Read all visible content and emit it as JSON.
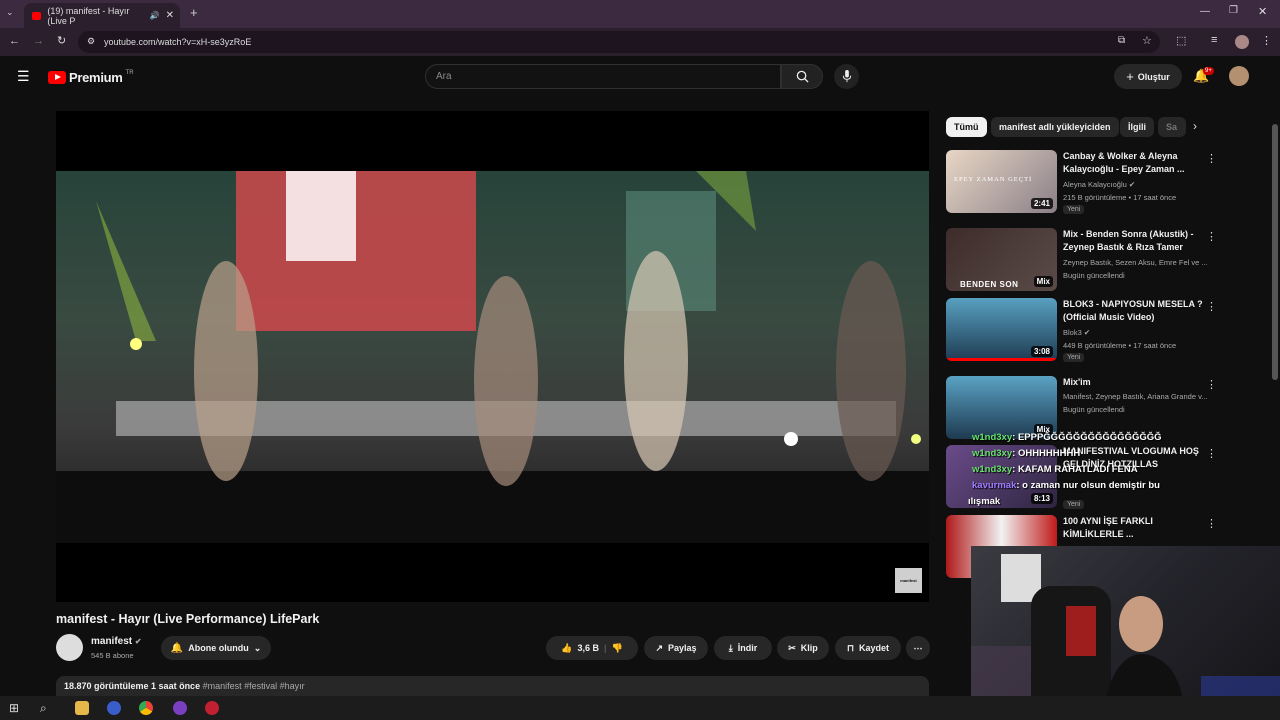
{
  "browser": {
    "tab_title": "(19) manifest - Hayır (Live P",
    "url": "youtube.com/watch?v=xH-se3yzRoE"
  },
  "header": {
    "logo_text": "Premium",
    "region": "TR",
    "search_placeholder": "Ara",
    "create_label": "Oluştur",
    "notif_count": "9+"
  },
  "video": {
    "title": "manifest - Hayır (Live Performance) LifePark",
    "watermark": "manifest",
    "channel": "manifest",
    "subscribers": "545 B abone",
    "subscribed_label": "Abone olundu",
    "likes": "3,6 B",
    "share_label": "Paylaş",
    "download_label": "İndir",
    "clip_label": "Klip",
    "save_label": "Kaydet",
    "views": "18.870 görüntüleme",
    "posted": "1 saat önce",
    "tags": "#manifest #festival #hayır"
  },
  "chips": [
    "Tümü",
    "manifest adlı yükleyiciden",
    "İlgili",
    "Sa"
  ],
  "recommendations": [
    {
      "title": "Canbay & Wolker & Aleyna Kalaycıoğlu - Epey Zaman ...",
      "channel": "Aleyna Kalaycıoğlu",
      "meta": "215 B görüntüleme • 17 saat önce",
      "badge": "Yeni",
      "duration": "2:41",
      "thumb_text": "EPEY ZAMAN GEÇTİ"
    },
    {
      "title": "Mix - Benden Sonra (Akustik) - Zeynep Bastık & Rıza Tamer",
      "channel": "Zeynep Bastık, Sezen Aksu, Emre Fel ve ...",
      "meta": "Bugün güncellendi",
      "badge": "",
      "duration": "Mix",
      "thumb_text": "BENDEN SON"
    },
    {
      "title": "BLOK3 - NAPIYOSUN MESELA ? (Official Music Video)",
      "channel": "Blok3",
      "meta": "449 B görüntüleme • 17 saat önce",
      "badge": "Yeni",
      "duration": "3:08",
      "thumb_text": ""
    },
    {
      "title": "Mix'im",
      "channel": "Manifest, Zeynep Bastık, Ariana Grande v...",
      "meta": "Bugün güncellendi",
      "badge": "",
      "duration": "Mix",
      "thumb_text": ""
    },
    {
      "title": "MANIFESTIVAL VLOGUMA HOŞ GELDİNİZ HOTZILLAS",
      "channel": "",
      "meta": "",
      "badge": "Yeni",
      "duration": "8:13",
      "thumb_text": ""
    },
    {
      "title": "100 AYNI İŞE FARKLI KİMLİKLERLE ...",
      "channel": "",
      "meta": "",
      "badge": "",
      "duration": "",
      "thumb_text": ""
    }
  ],
  "chat": [
    {
      "user": "w1nd3xy",
      "msg": ": EPPPĞĞĞĞĞĞĞĞĞĞĞĞĞĞĞĞ"
    },
    {
      "user": "w1nd3xy",
      "msg": ": OHHHHHHHH"
    },
    {
      "user": "w1nd3xy",
      "msg": ": KAFAM RAHATLADI FENA"
    },
    {
      "user": "kavurmak",
      "msg": ": o zaman nur olsun demiştir bu"
    },
    {
      "user": "",
      "msg": "ılışmak"
    }
  ],
  "colors": {
    "bg": "#0f0f0f",
    "brand": "#ff0000",
    "chip": "#272727"
  }
}
